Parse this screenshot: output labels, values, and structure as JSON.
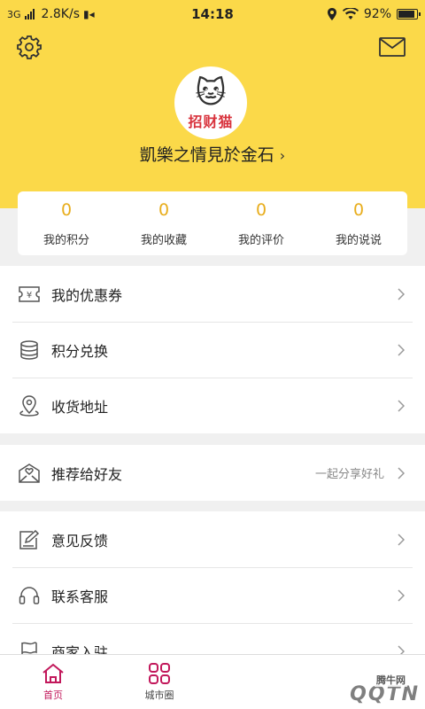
{
  "status_bar": {
    "network": "3G",
    "speed": "2.8K/s",
    "time": "14:18",
    "battery": "92%"
  },
  "profile": {
    "logo_text": "招财猫",
    "username": "凱樂之情見於金石",
    "chevron": "›"
  },
  "stats": [
    {
      "value": "0",
      "label": "我的积分"
    },
    {
      "value": "0",
      "label": "我的收藏"
    },
    {
      "value": "0",
      "label": "我的评价"
    },
    {
      "value": "0",
      "label": "我的说说"
    }
  ],
  "menu_group_1": [
    {
      "icon": "coupon-icon",
      "label": "我的优惠券"
    },
    {
      "icon": "coins-icon",
      "label": "积分兑换"
    },
    {
      "icon": "location-icon",
      "label": "收货地址"
    }
  ],
  "menu_group_2": [
    {
      "icon": "share-envelope-icon",
      "label": "推荐给好友",
      "note": "一起分享好礼"
    }
  ],
  "menu_group_3": [
    {
      "icon": "feedback-icon",
      "label": "意见反馈"
    },
    {
      "icon": "headset-icon",
      "label": "联系客服"
    },
    {
      "icon": "flag-icon",
      "label": "商家入驻"
    }
  ],
  "tabs": [
    {
      "icon": "home-icon",
      "label": "首页",
      "active": true
    },
    {
      "icon": "grid-icon",
      "label": "城市圈",
      "active": false
    }
  ],
  "watermark": {
    "text": "QQTN",
    "sub": "腾牛网"
  },
  "colors": {
    "brand_yellow": "#fbd949",
    "stat_number": "#e8ad1c",
    "tab_active": "#c2185b"
  }
}
